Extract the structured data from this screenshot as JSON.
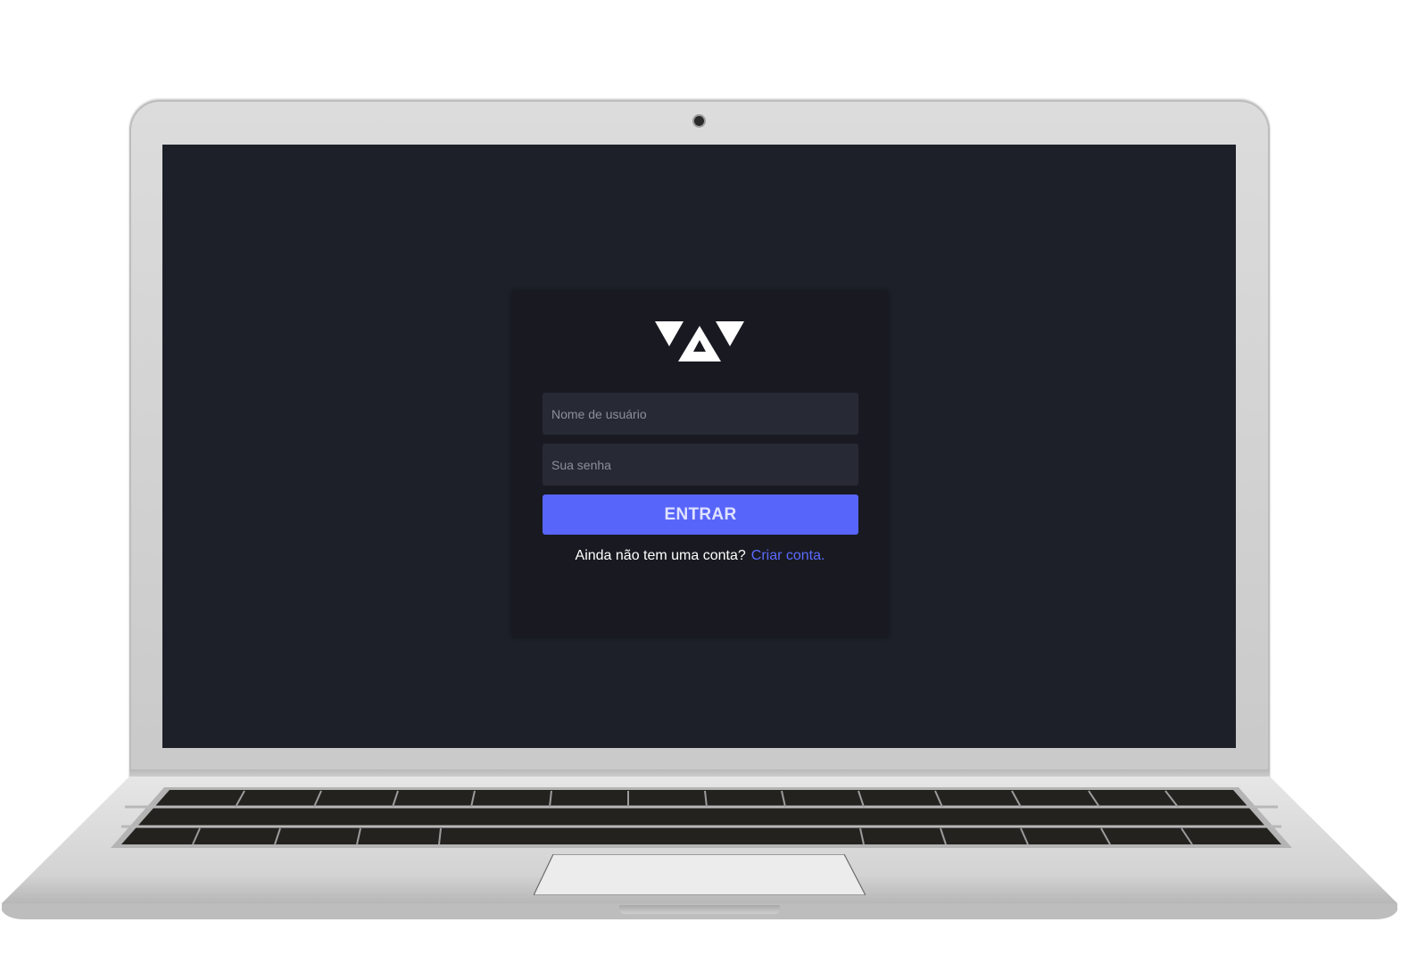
{
  "login": {
    "username_placeholder": "Nome de usuário",
    "password_placeholder": "Sua senha",
    "submit_label": "ENTRAR",
    "signup_prompt": "Ainda não tem uma conta?",
    "signup_link": "Criar conta."
  },
  "icons": {
    "logo": "triangle-logo-icon",
    "camera": "webcam-icon"
  },
  "colors": {
    "screen_background": "#1d2028",
    "card_background": "#191a21",
    "input_background": "#272a35",
    "button_accent": "#5865fa",
    "link": "#5b6bff",
    "laptop_body": "#d9d9d9"
  }
}
